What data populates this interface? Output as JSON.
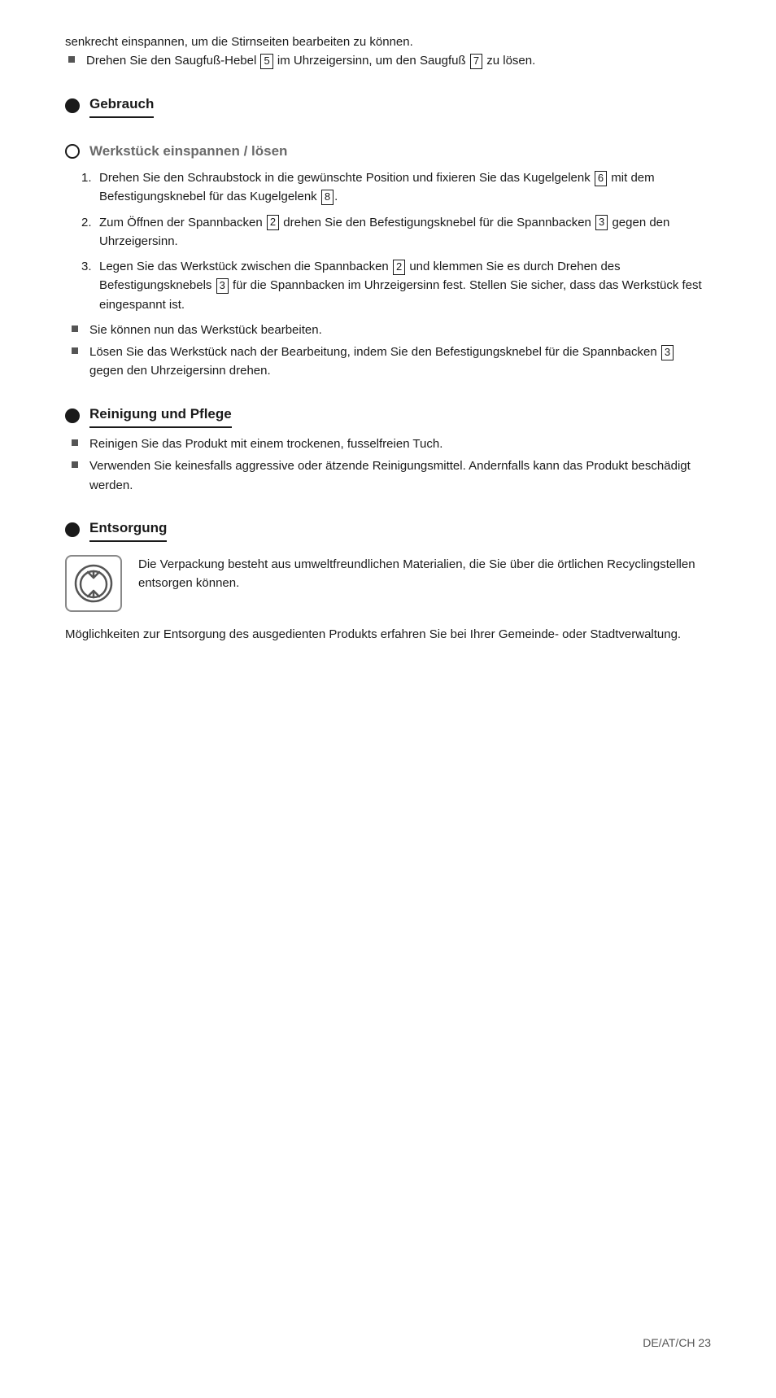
{
  "page": {
    "background": "#e8e8e8",
    "footer": {
      "label": "DE/AT/CH   23"
    }
  },
  "content": {
    "intro_lines": [
      "senkrecht einspannen, um die Stirnseiten bearbeiten zu können.",
      "Drehen Sie den Saugfuß-Hebel [5] im Uhrzeigersinn, um den Saugfuß [7] zu lösen."
    ],
    "sections": [
      {
        "id": "gebrauch",
        "dot": "filled",
        "title": "Gebrauch",
        "title_style": "underline",
        "content_type": "none"
      },
      {
        "id": "werkstuck",
        "dot": "outline",
        "title": "Werkstück einspannen / lösen",
        "title_style": "gray",
        "content_type": "numbered",
        "numbered_items": [
          {
            "num": "1.",
            "text": "Drehen Sie den Schraubstock in die gewünschte Position und fixieren Sie das Kugelgelenk [6] mit dem Befestigungsknebel für das Kugelgelenk [8].",
            "refs": {
              "6": true,
              "8": true
            }
          },
          {
            "num": "2.",
            "text": "Zum Öffnen der Spannbacken [2] drehen Sie den Befestigungsknebel für die Spannbacken [3] gegen den Uhrzeigersinn.",
            "refs": {
              "2": true,
              "3": true
            }
          },
          {
            "num": "3.",
            "text": "Legen Sie das Werkstück zwischen die Spannbacken [2] und klemmen Sie es durch Drehen des Befestigungsknebels [3] für die Spannbacken im Uhrzeigersinn fest. Stellen Sie sicher, dass das Werkstück fest eingespannt ist.",
            "refs": {
              "2": true,
              "3": true
            }
          }
        ],
        "bullet_items": [
          "Sie können nun das Werkstück bearbeiten.",
          "Lösen Sie das Werkstück nach der Bearbeitung, indem Sie den Befestigungsknebel für die Spannbacken [3] gegen den Uhrzeigersinn drehen."
        ]
      },
      {
        "id": "reinigung",
        "dot": "filled",
        "title": "Reinigung und Pflege",
        "title_style": "underline",
        "content_type": "bullets",
        "bullet_items": [
          "Reinigen Sie das Produkt mit einem trockenen, fusselfreien Tuch.",
          "Verwenden Sie keinesfalls aggressive oder ätzende Reinigungsmittel. Andernfalls kann das Produkt beschädigt werden."
        ]
      },
      {
        "id": "entsorgung",
        "dot": "filled",
        "title": "Entsorgung",
        "title_style": "underline",
        "content_type": "recycle",
        "recycle_text": "Die Verpackung besteht aus umweltfreundlichen Materialien, die Sie über die örtlichen Recyclingstellen entsorgen können.",
        "final_text": "Möglichkeiten zur Entsorgung des ausgedienten Produkts erfahren Sie bei Ihrer Gemeinde- oder Stadtverwaltung."
      }
    ]
  }
}
